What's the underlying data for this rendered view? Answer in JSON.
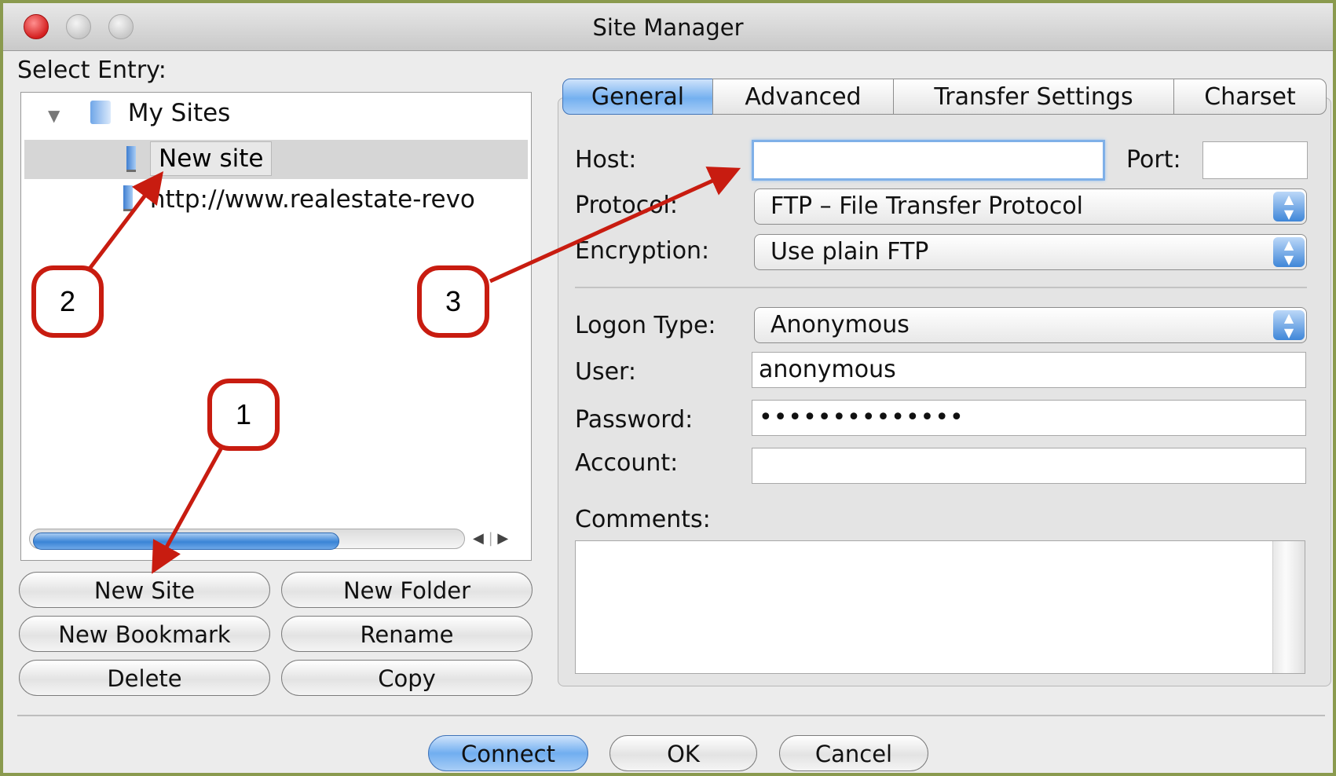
{
  "window": {
    "title": "Site Manager"
  },
  "left_panel": {
    "select_entry_label": "Select Entry:",
    "tree": {
      "root_label": "My Sites",
      "items": [
        {
          "label": "New site",
          "selected": true
        },
        {
          "label": "http://www.realestate-revo"
        }
      ]
    },
    "buttons": {
      "new_site": "New Site",
      "new_folder": "New Folder",
      "new_bookmark": "New Bookmark",
      "rename": "Rename",
      "delete": "Delete",
      "copy": "Copy"
    }
  },
  "tabs": [
    {
      "label": "General",
      "active": true
    },
    {
      "label": "Advanced",
      "active": false
    },
    {
      "label": "Transfer Settings",
      "active": false
    },
    {
      "label": "Charset",
      "active": false
    }
  ],
  "general": {
    "host_label": "Host:",
    "host_value": "",
    "port_label": "Port:",
    "port_value": "",
    "protocol_label": "Protocol:",
    "protocol_value": "FTP – File Transfer Protocol",
    "encryption_label": "Encryption:",
    "encryption_value": "Use plain FTP",
    "logon_type_label": "Logon Type:",
    "logon_type_value": "Anonymous",
    "user_label": "User:",
    "user_value": "anonymous",
    "password_label": "Password:",
    "password_value": "••••••••••••••",
    "account_label": "Account:",
    "account_value": "",
    "comments_label": "Comments:",
    "comments_value": ""
  },
  "footer": {
    "connect": "Connect",
    "ok": "OK",
    "cancel": "Cancel"
  },
  "annotations": [
    {
      "number": "1"
    },
    {
      "number": "2"
    },
    {
      "number": "3"
    }
  ],
  "colors": {
    "callout_red": "#c81c10",
    "accent_blue": "#74b0f0",
    "frame_green": "#8a9a4e"
  }
}
